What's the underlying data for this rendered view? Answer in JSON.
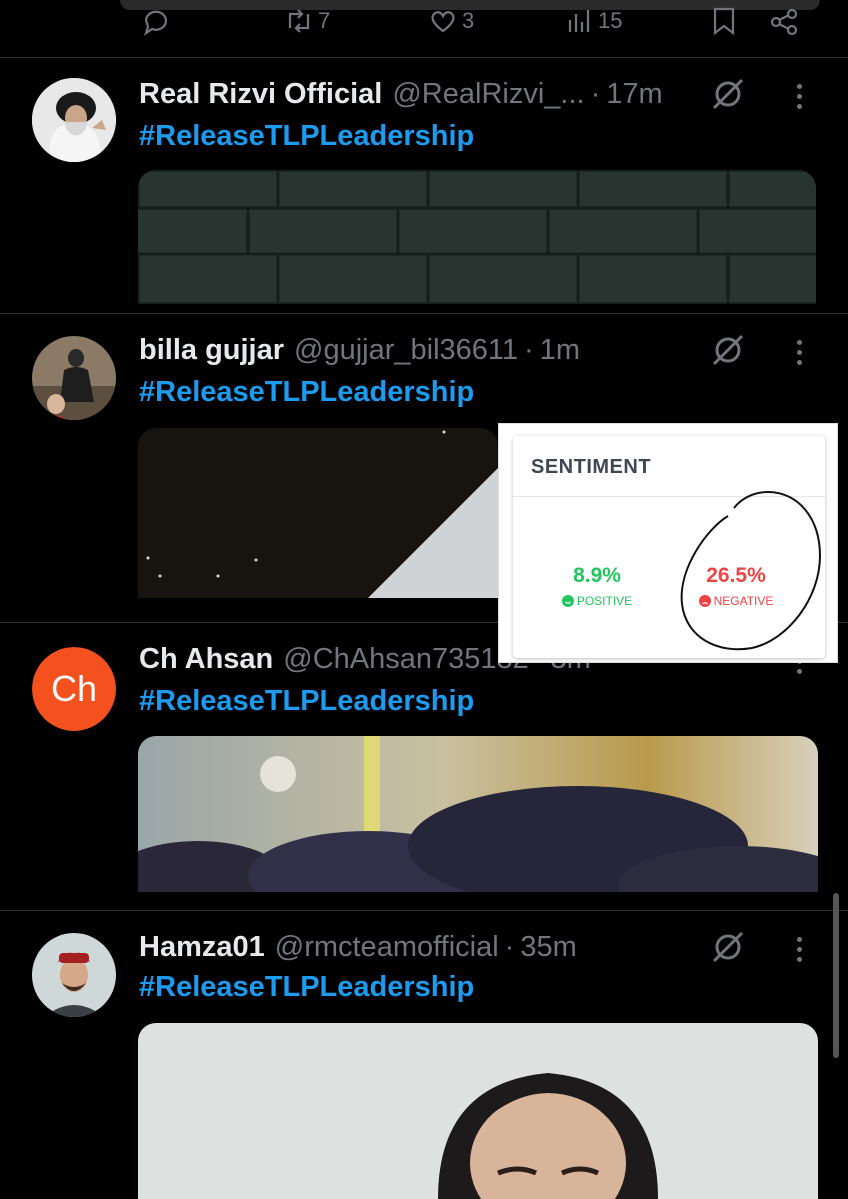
{
  "action_bar": {
    "retweets": "7",
    "likes": "3",
    "views": "15"
  },
  "tweets": [
    {
      "name": "Real Rizvi Official",
      "handle": "@RealRizvi_...",
      "separator": "·",
      "time": "17m",
      "hashtag": "#ReleaseTLPLeadership"
    },
    {
      "name": "billa gujjar",
      "handle": "@gujjar_bil36611",
      "separator": "·",
      "time": "1m",
      "hashtag": "#ReleaseTLPLeadership"
    },
    {
      "name": "Ch Ahsan",
      "handle": "@ChAhsan735182",
      "separator": "·",
      "time": "3m",
      "hashtag": "#ReleaseTLPLeadership",
      "avatar_initials": "Ch",
      "avatar_color": "#f4511e"
    },
    {
      "name": "Hamza01",
      "handle": "@rmcteamofficial",
      "separator": "·",
      "time": "35m",
      "hashtag": "#ReleaseTLPLeadership"
    }
  ],
  "sentiment": {
    "title": "SENTIMENT",
    "positive_value": "8.9%",
    "positive_label": "POSITIVE",
    "negative_value": "26.5%",
    "negative_label": "NEGATIVE"
  },
  "colors": {
    "background": "#000000",
    "hashtag": "#1d9bf0",
    "muted": "#71767b",
    "positive": "#22c55e",
    "negative": "#ef4444"
  }
}
